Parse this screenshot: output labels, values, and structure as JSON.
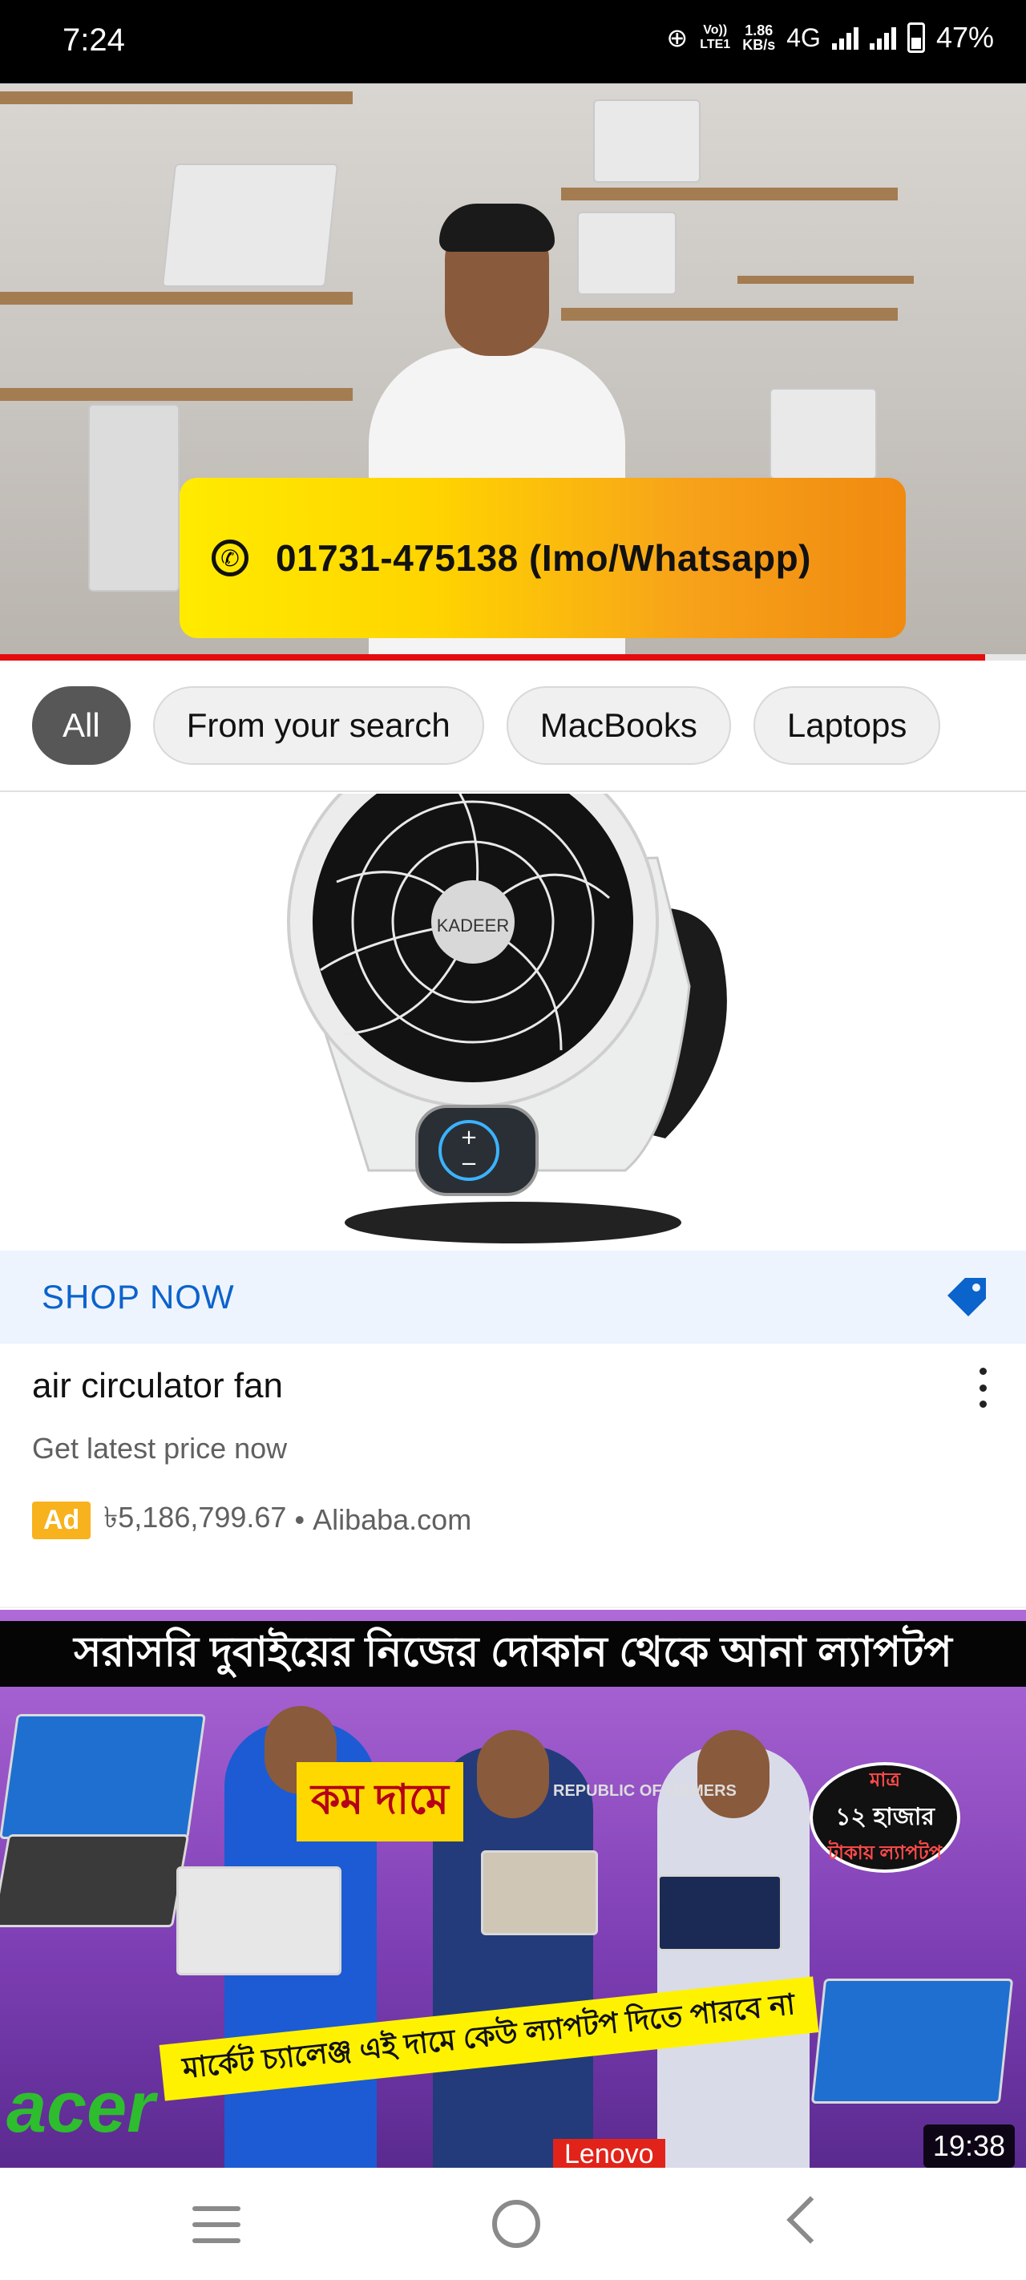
{
  "status_bar": {
    "time": "7:24",
    "volte": "Vo)) LTE1",
    "speed_value": "1.86",
    "speed_unit": "KB/s",
    "network": "4G",
    "battery": "47%"
  },
  "video": {
    "banner_text": "01731-475138 (Imo/Whatsapp)",
    "progress_fraction": 0.96,
    "progress_color": "#e40d0d"
  },
  "chips": [
    {
      "label": "All",
      "selected": true
    },
    {
      "label": "From your search",
      "selected": false
    },
    {
      "label": "MacBooks",
      "selected": false
    },
    {
      "label": "Laptops",
      "selected": false
    }
  ],
  "ad": {
    "cta_label": "SHOP NOW",
    "cta_icon": "tag-icon",
    "title": "air circulator fan",
    "description": "Get latest price now",
    "badge": "Ad",
    "price": "৳5,186,799.67",
    "separator": "•",
    "domain": "Alibaba.com",
    "product_brand": "KADEER",
    "accent_color": "#0b63cc"
  },
  "video_card": {
    "headline": "সরাসরি দুবাইয়ের নিজের দোকান থেকে আনা ল্যাপটপ",
    "price_badge_top": "মাত্র",
    "price_badge_mid": "১২ হাজার",
    "price_badge_bottom": "টাকায় ল্যাপটপ",
    "kom_dame": "কম দামে",
    "challenge_banner": "মার্কেট চ্যালেঞ্জ এই দামে কেউ ল্যাপটপ দিতে পারবে না",
    "brand_acer": "acer",
    "brand_lenovo": "Lenovo",
    "brand_rog": "REPUBLIC OF GAMERS",
    "duration": "19:38"
  },
  "nav": {
    "icons": [
      "menu-icon",
      "home-icon",
      "back-icon"
    ]
  }
}
